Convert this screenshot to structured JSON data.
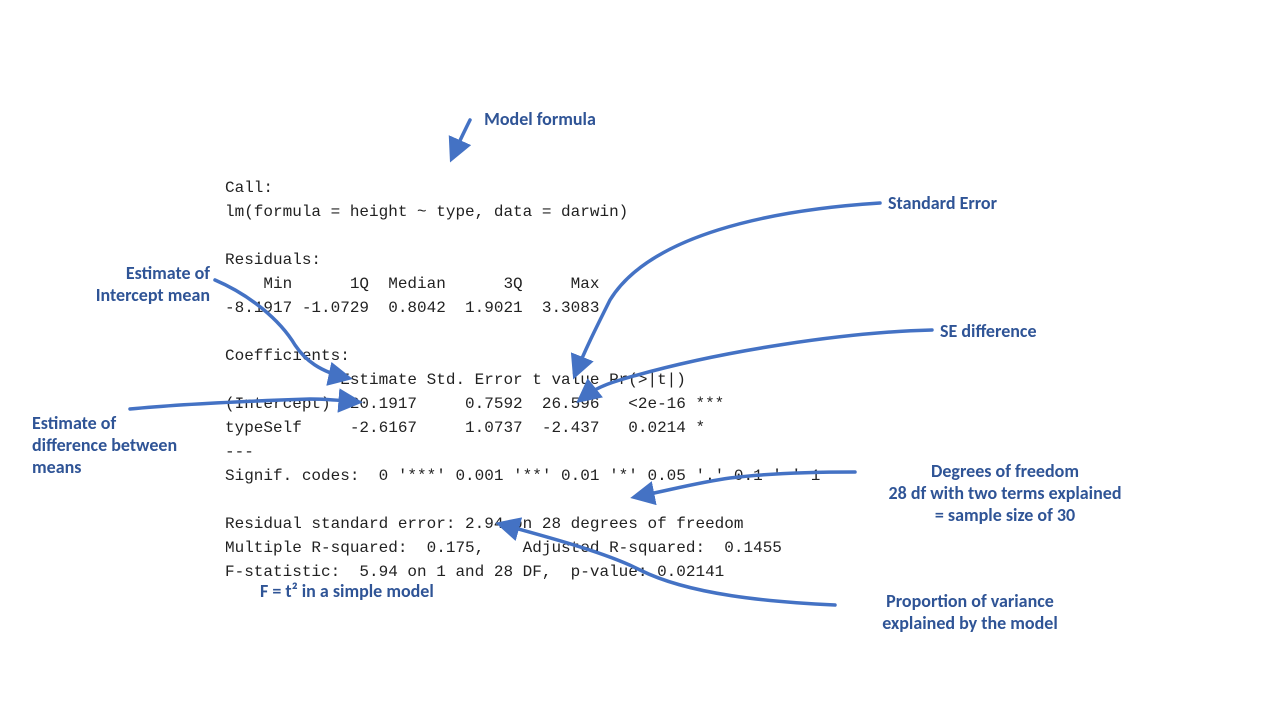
{
  "code_lines": {
    "l0": "Call:",
    "l1": "lm(formula = height ~ type, data = darwin)",
    "l2": "",
    "l3": "Residuals:",
    "l4": "    Min      1Q  Median      3Q     Max",
    "l5": "-8.1917 -1.0729  0.8042  1.9021  3.3083",
    "l6": "",
    "l7": "Coefficients:",
    "l8": "            Estimate Std. Error t value Pr(>|t|)",
    "l9": "(Intercept)  20.1917     0.7592  26.596   <2e-16 ***",
    "l10": "typeSelf     -2.6167     1.0737  -2.437   0.0214 *",
    "l11": "---",
    "l12": "Signif. codes:  0 '***' 0.001 '**' 0.01 '*' 0.05 '.' 0.1 ' ' 1",
    "l13": "",
    "l14": "Residual standard error: 2.94 on 28 degrees of freedom",
    "l15": "Multiple R-squared:  0.175,    Adjusted R-squared:  0.1455",
    "l16": "F-statistic:  5.94 on 1 and 28 DF,  p-value: 0.02141"
  },
  "labels": {
    "model_formula": "Model formula",
    "standard_error": "Standard Error",
    "intercept_mean_1": "Estimate of",
    "intercept_mean_2": "Intercept mean",
    "se_difference": "SE difference",
    "diff_means_1": "Estimate of",
    "diff_means_2": "difference between",
    "diff_means_3": "means",
    "df_1": "Degrees of freedom",
    "df_2": "28 df with two terms explained",
    "df_3": "= sample size of 30",
    "f_note": "F = t² in a simple model",
    "var_expl_1": "Proportion of variance",
    "var_expl_2": "explained by the model"
  }
}
